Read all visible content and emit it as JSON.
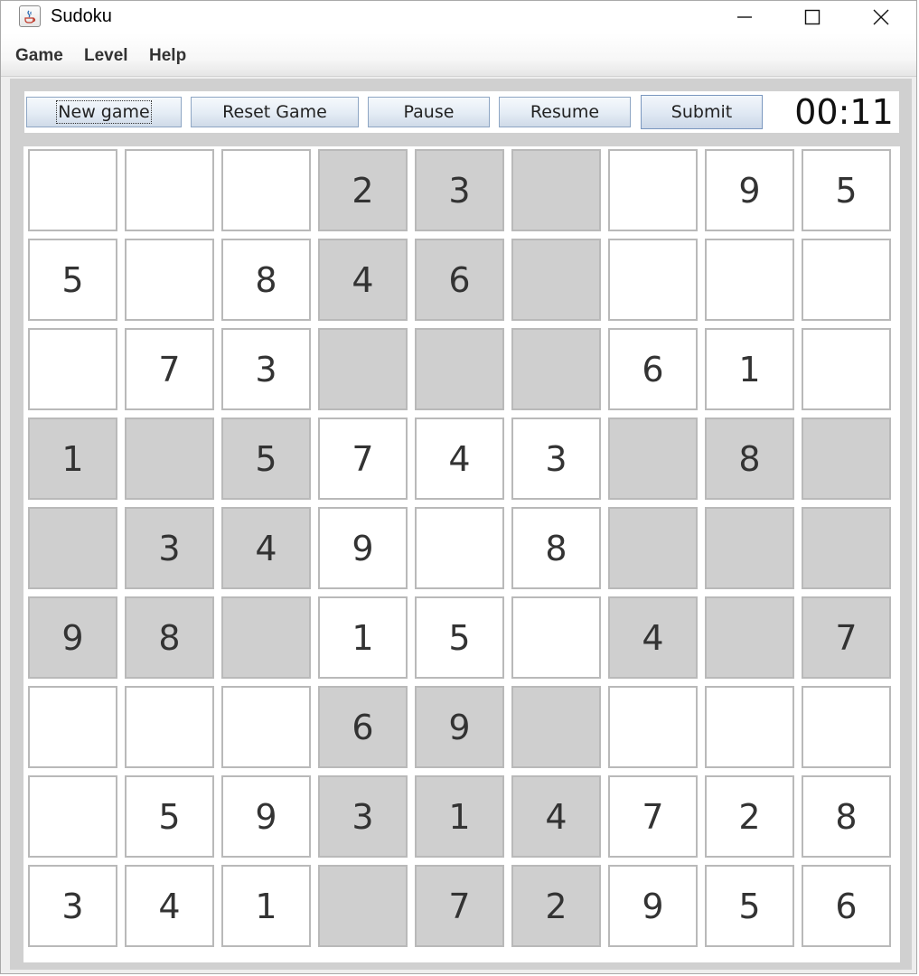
{
  "window": {
    "title": "Sudoku",
    "controls": {
      "minimize": "minimize",
      "maximize": "maximize",
      "close": "close"
    }
  },
  "menu": [
    "Game",
    "Level",
    "Help"
  ],
  "toolbar": {
    "new_game": "New game",
    "reset_game": "Reset Game",
    "pause": "Pause",
    "resume": "Resume",
    "submit": "Submit",
    "timer": "00:11"
  },
  "colors": {
    "shaded_box": "#cfcfcf",
    "light_box": "#ffffff",
    "cell_border": "#b9b9b9"
  },
  "board": [
    [
      "",
      "",
      "",
      "2",
      "3",
      "",
      "",
      "9",
      "5"
    ],
    [
      "5",
      "",
      "8",
      "4",
      "6",
      "",
      "",
      "",
      ""
    ],
    [
      "",
      "7",
      "3",
      "",
      "",
      "",
      "6",
      "1",
      ""
    ],
    [
      "1",
      "",
      "5",
      "7",
      "4",
      "3",
      "",
      "8",
      ""
    ],
    [
      "",
      "3",
      "4",
      "9",
      "",
      "8",
      "",
      "",
      ""
    ],
    [
      "9",
      "8",
      "",
      "1",
      "5",
      "",
      "4",
      "",
      "7"
    ],
    [
      "",
      "",
      "",
      "6",
      "9",
      "",
      "",
      "",
      ""
    ],
    [
      "",
      "5",
      "9",
      "3",
      "1",
      "4",
      "7",
      "2",
      "8"
    ],
    [
      "3",
      "4",
      "1",
      "",
      "7",
      "2",
      "9",
      "5",
      "6"
    ]
  ]
}
